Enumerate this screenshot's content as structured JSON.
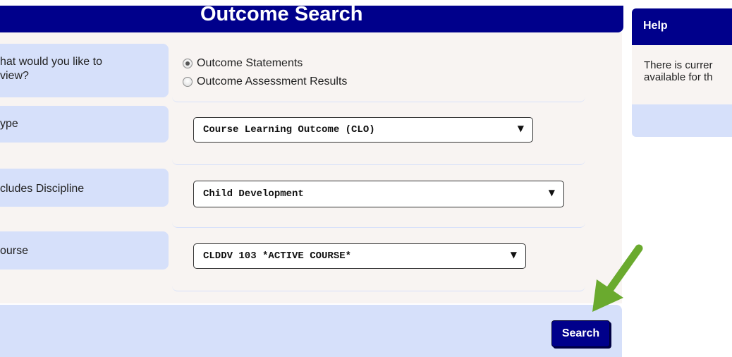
{
  "outcome_search": {
    "title": "Outcome Search",
    "view_label_line1": "hat would you like to",
    "view_label_line2": "view?",
    "view_options": [
      {
        "label": "Outcome Statements",
        "checked": true
      },
      {
        "label": "Outcome Assessment Results",
        "checked": false
      }
    ],
    "type_label": "ype",
    "type_value": "Course Learning Outcome (CLO)",
    "discipline_label": "cludes Discipline",
    "discipline_value": "Child Development",
    "course_label": "ourse",
    "course_value": "CLDDV 103 *ACTIVE COURSE*",
    "search_button": "Search"
  },
  "help": {
    "title": "Help",
    "line1": "There is currer",
    "line2": "available for th"
  },
  "icons": {
    "dropdown_caret": "▼",
    "annotation": "green-arrow-icon"
  },
  "colors": {
    "header_blue": "#00008b",
    "label_bg": "#d6e0fa",
    "panel_bg": "#f8f4f2",
    "arrow_green": "#6aaa2e"
  }
}
